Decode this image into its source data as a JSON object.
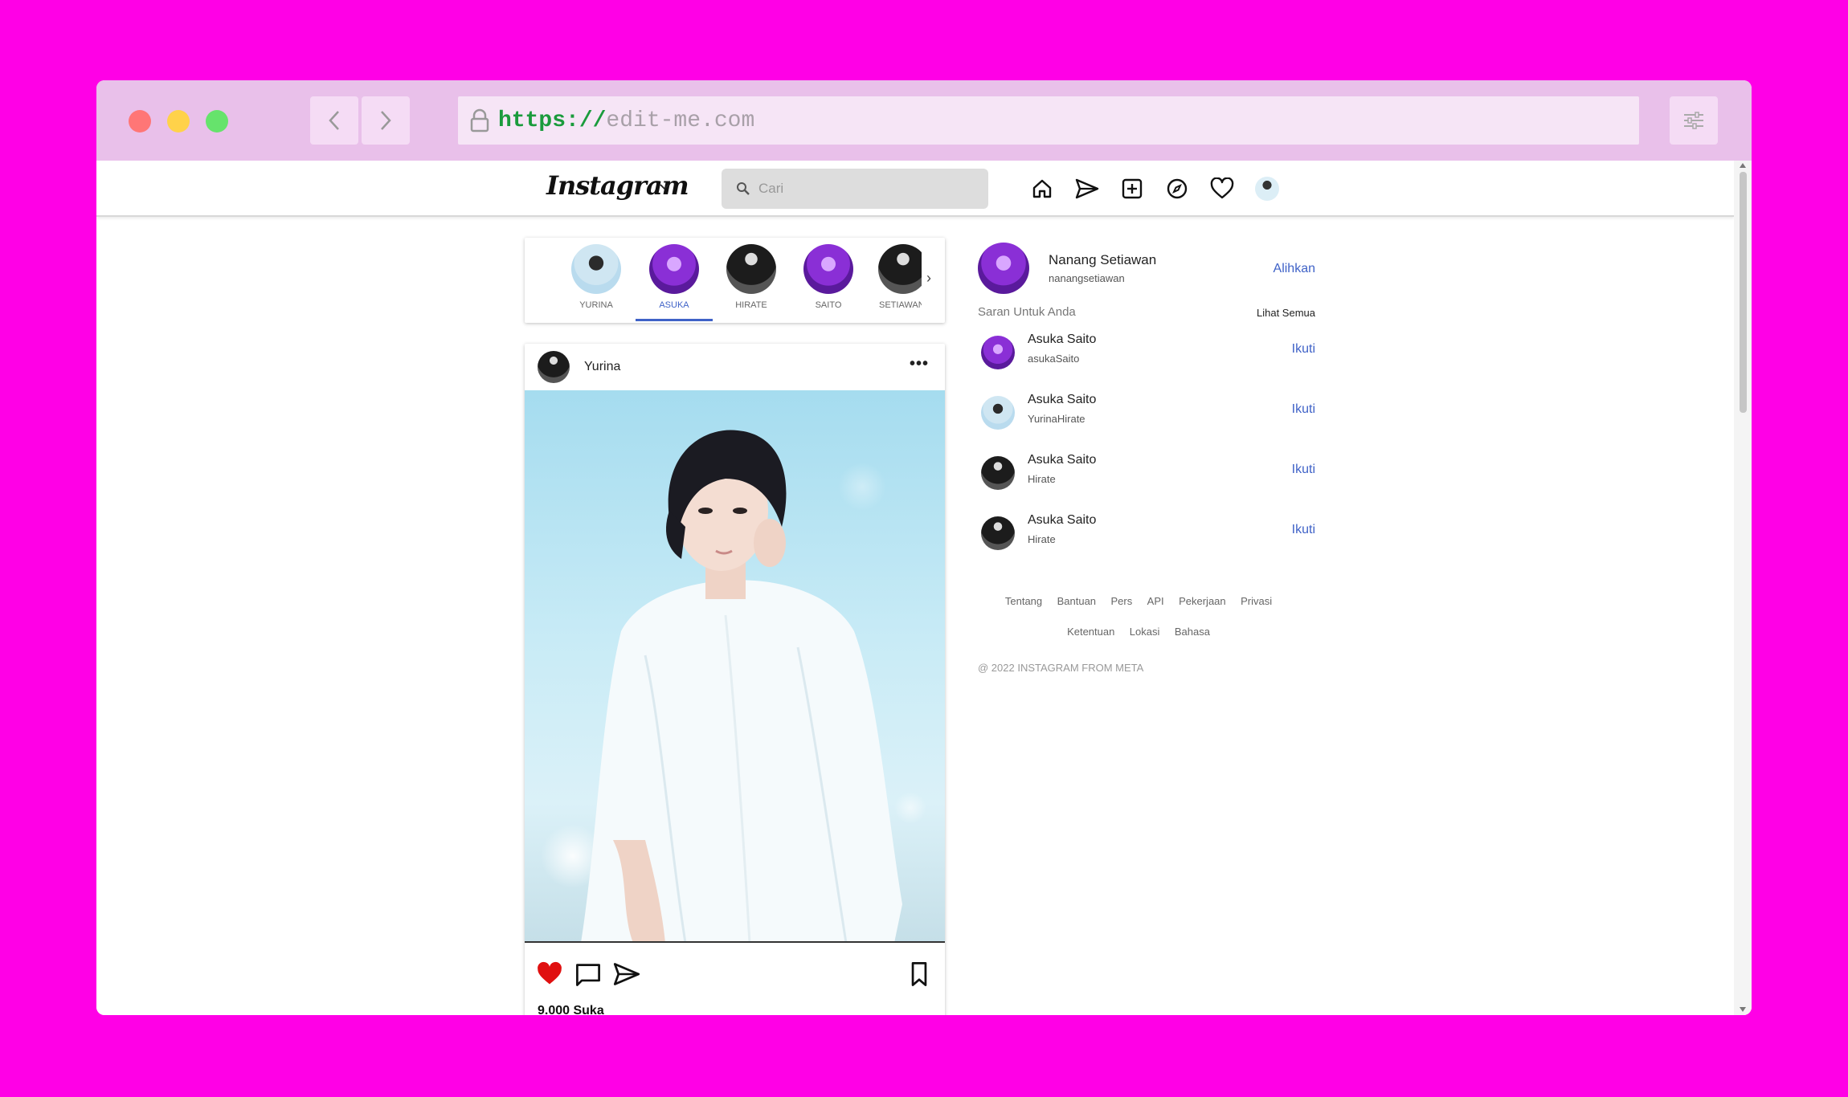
{
  "browser": {
    "url_scheme": "https://",
    "url_host": "edit-me.com"
  },
  "header": {
    "logo": "Instagram",
    "search_placeholder": "Cari",
    "icons": [
      "home-icon",
      "send-icon",
      "add-post-icon",
      "explore-icon",
      "heart-icon",
      "profile-avatar"
    ]
  },
  "stories": [
    {
      "name": "YURINA",
      "avatar": "light"
    },
    {
      "name": "ASUKA",
      "avatar": "purple",
      "active": true
    },
    {
      "name": "HIRATE",
      "avatar": "dark"
    },
    {
      "name": "SAITO",
      "avatar": "purple"
    },
    {
      "name": "SETIAWAN",
      "avatar": "dark"
    }
  ],
  "post": {
    "username": "Yurina",
    "likes": "9.000 Suka",
    "liked": true
  },
  "sidebar": {
    "me": {
      "name": "Nanang Setiawan",
      "handle": "nanangsetiawan",
      "switch_label": "Alihkan"
    },
    "suggestions_title": "Saran Untuk Anda",
    "see_all": "Lihat Semua",
    "follow_label": "Ikuti",
    "suggestions": [
      {
        "name": "Asuka Saito",
        "handle": "asukaSaito",
        "avatar": "purple"
      },
      {
        "name": "Asuka Saito",
        "handle": "YurinaHirate",
        "avatar": "light"
      },
      {
        "name": "Asuka Saito",
        "handle": "Hirate",
        "avatar": "dark"
      },
      {
        "name": "Asuka Saito",
        "handle": "Hirate",
        "avatar": "dark"
      }
    ],
    "footer_links": [
      "Tentang",
      "Bantuan",
      "Pers",
      "API",
      "Pekerjaan",
      "Privasi",
      "Ketentuan",
      "Lokasi",
      "Bahasa"
    ],
    "copyright": "@ 2022 INSTAGRAM FROM META"
  },
  "colors": {
    "background": "#ff00e6",
    "chrome": "#e9c0ea",
    "accent": "#3f62c7",
    "like": "#e01010"
  }
}
